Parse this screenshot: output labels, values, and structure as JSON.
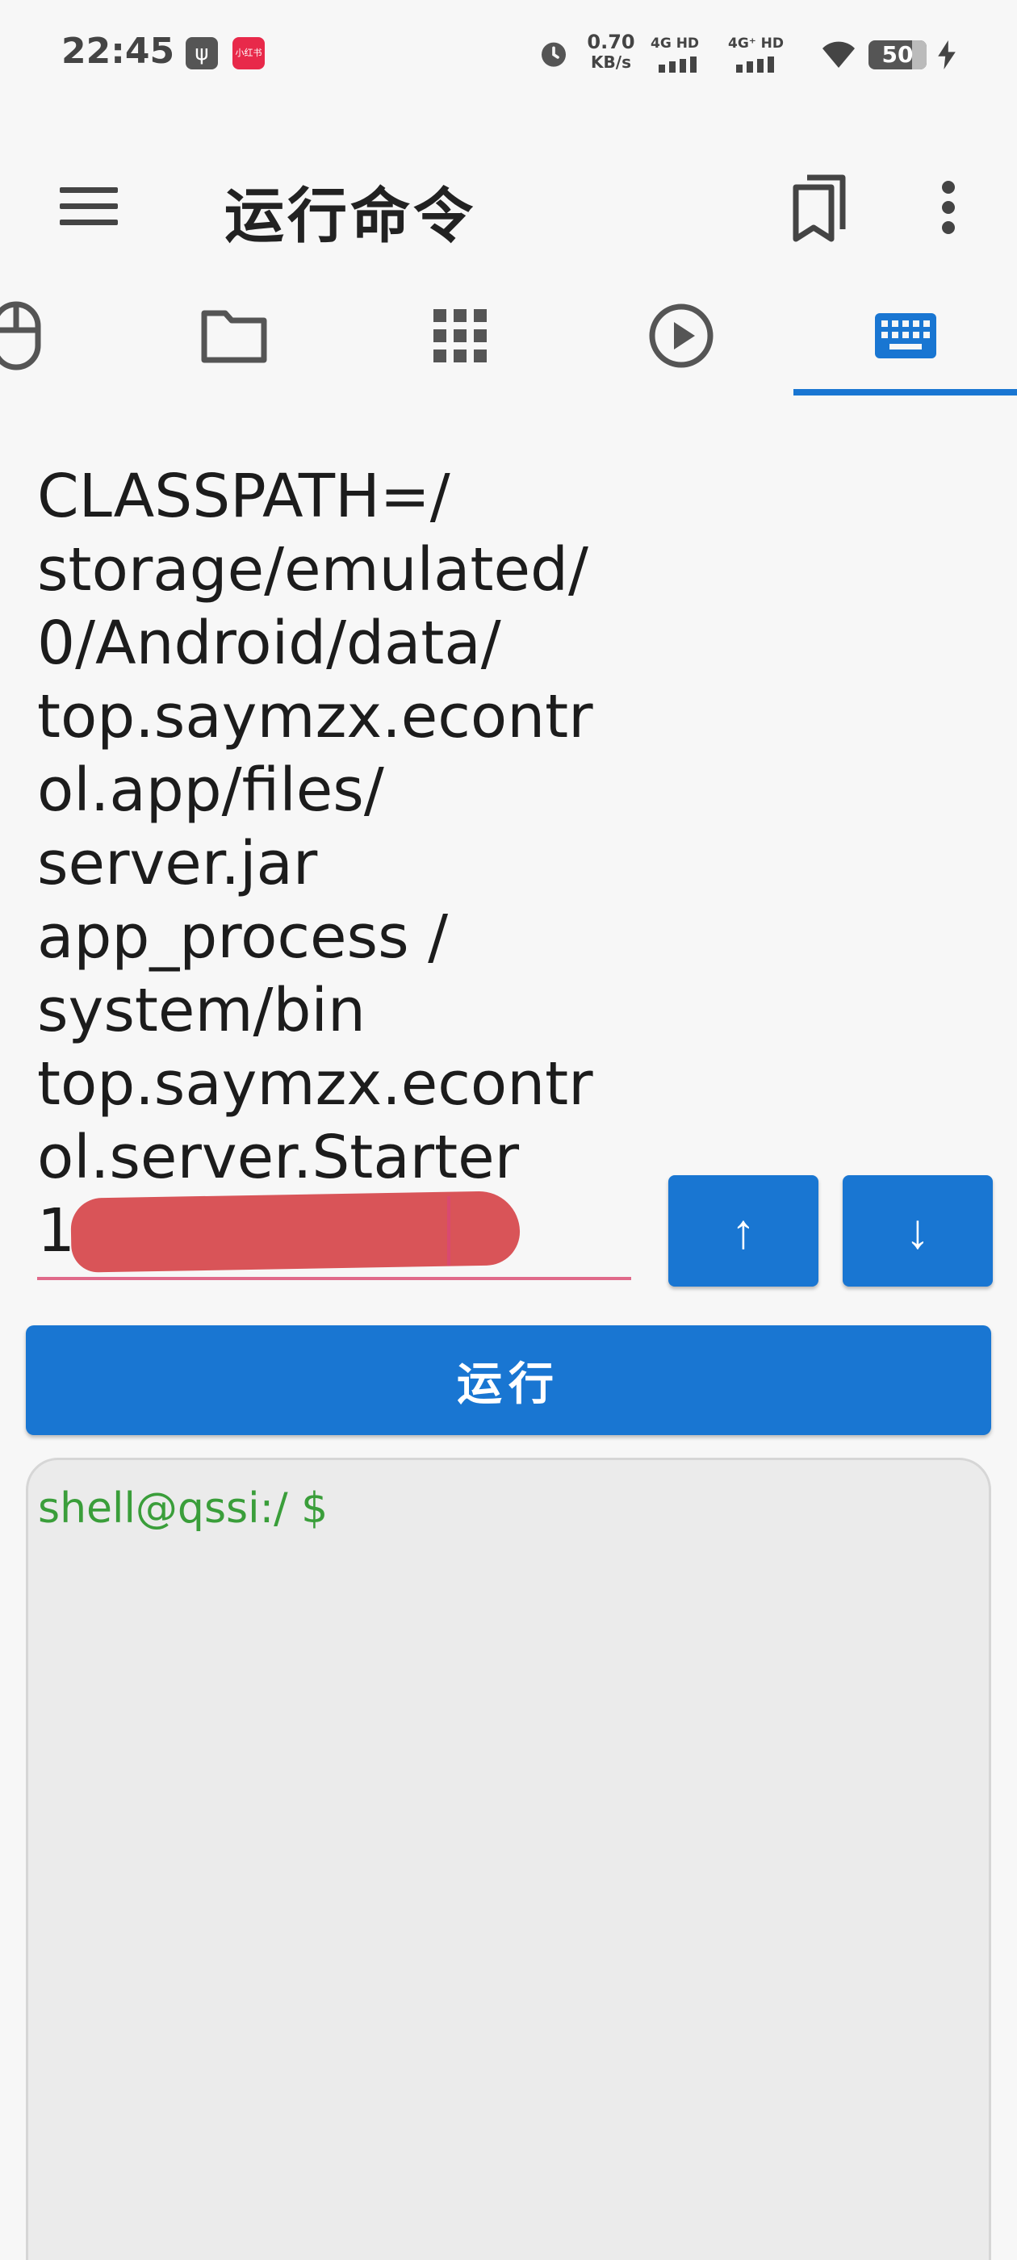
{
  "status_bar": {
    "time": "22:45",
    "usb_glyph": "ψ",
    "app_badge": "小红书",
    "net_speed_value": "0.70",
    "net_speed_unit": "KB/s",
    "signal1_label": "4G HD",
    "signal2_label": "4G⁺ HD",
    "battery": "50"
  },
  "app_bar": {
    "title": "运行命令",
    "icons": [
      "menu-icon",
      "bookmarks-icon",
      "more-vert-icon"
    ]
  },
  "tabs": [
    {
      "icon": "mouse-icon",
      "selected": false
    },
    {
      "icon": "folder-icon",
      "selected": false
    },
    {
      "icon": "apps-grid-icon",
      "selected": false
    },
    {
      "icon": "play-circle-icon",
      "selected": false
    },
    {
      "icon": "keyboard-icon",
      "selected": true
    }
  ],
  "command": {
    "text": "CLASSPATH=/\nstorage/emulated/\n0/Android/data/\ntop.saymzx.econtr\nol.app/files/\nserver.jar\napp_process /\nsystem/bin\ntop.saymzx.econtr\nol.server.Starter\n15",
    "history_up_label": "↑",
    "history_down_label": "↓"
  },
  "run_button": {
    "label": "运行"
  },
  "terminal": {
    "prompt": "shell@qssi:/ $"
  },
  "colors": {
    "accent": "#1976d2",
    "prompt": "#3a9e3a",
    "input_underline": "#e06a8a",
    "redaction": "#d95458"
  }
}
